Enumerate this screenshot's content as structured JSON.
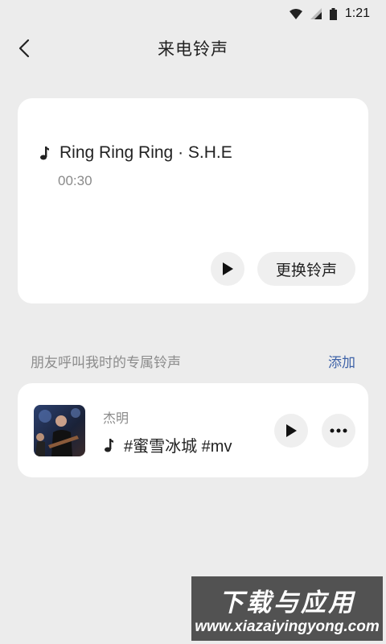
{
  "status_bar": {
    "time": "1:21",
    "icons": [
      "wifi-icon",
      "cellular-signal-icon",
      "battery-icon"
    ]
  },
  "header": {
    "back_icon": "chevron-left-icon",
    "title": "来电铃声"
  },
  "current_ringtone": {
    "song": "Ring Ring Ring · S.H.E",
    "duration": "00:30",
    "play_icon": "play-icon",
    "change_label": "更换铃声"
  },
  "contacts_section": {
    "label": "朋友呼叫我时的专属铃声",
    "add_label": "添加",
    "add_color": "#3f63a8"
  },
  "contact_ringtones": [
    {
      "name": "杰明",
      "song": "#蜜雪冰城 #mv",
      "avatar": "avatar-photo",
      "play_icon": "play-icon",
      "more_icon": "more-dots-icon"
    }
  ],
  "watermark": {
    "cn": "下载与应用",
    "en": "www.xiazaiyingyong.com"
  }
}
